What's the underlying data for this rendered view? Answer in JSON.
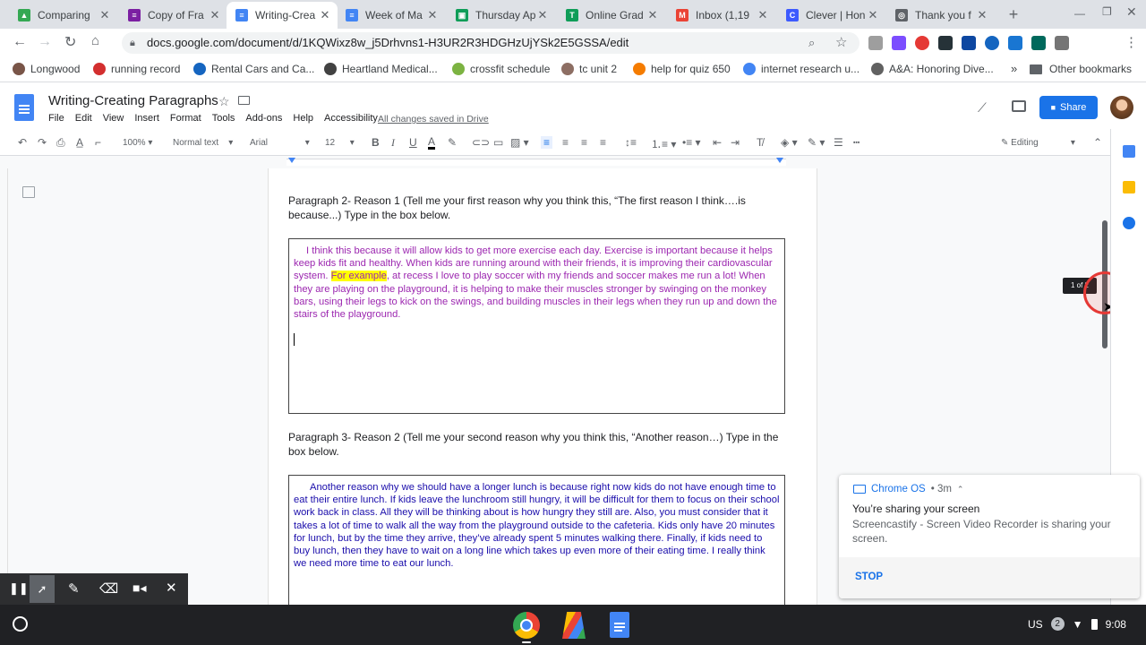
{
  "tabs": [
    {
      "label": "Comparing",
      "color": "#34a853",
      "glyph": "▲"
    },
    {
      "label": "Copy of Fra",
      "color": "#7b1fa2",
      "glyph": "≡"
    },
    {
      "label": "Writing-Crea",
      "color": "#4285f4",
      "glyph": "≡"
    },
    {
      "label": "Week of Ma",
      "color": "#4285f4",
      "glyph": "≡"
    },
    {
      "label": "Thursday Ap",
      "color": "#0f9d58",
      "glyph": "▣"
    },
    {
      "label": "Online Grad",
      "color": "#0f9d58",
      "glyph": "T"
    },
    {
      "label": "Inbox (1,19",
      "color": "#ea4335",
      "glyph": "M"
    },
    {
      "label": "Clever | Hon",
      "color": "#3d5afe",
      "glyph": "C"
    },
    {
      "label": "Thank you f",
      "color": "#5f6368",
      "glyph": "◎"
    }
  ],
  "url": "docs.google.com/document/d/1KQWixz8w_j5Drhvns1-H3UR2R3HDGHzUjYSk2E5GSSA/edit",
  "bookmarks": [
    {
      "label": "Longwood",
      "color": "#795548"
    },
    {
      "label": "running record",
      "color": "#d32f2f"
    },
    {
      "label": "Rental Cars and Ca...",
      "color": "#1565c0"
    },
    {
      "label": "Heartland Medical...",
      "color": "#424242"
    },
    {
      "label": "crossfit schedule",
      "color": "#7cb342"
    },
    {
      "label": "tc unit 2",
      "color": "#8d6e63"
    },
    {
      "label": "help for quiz 650",
      "color": "#f57c00"
    },
    {
      "label": "internet research u...",
      "color": "#4285f4"
    },
    {
      "label": "A&A: Honoring Dive...",
      "color": "#616161"
    }
  ],
  "bookmarks_more": "»",
  "other_bookmarks": "Other bookmarks",
  "doc": {
    "title": "Writing-Creating Paragraphs",
    "menus": [
      "File",
      "Edit",
      "View",
      "Insert",
      "Format",
      "Tools",
      "Add-ons",
      "Help",
      "Accessibility"
    ],
    "save_status": "All changes saved in Drive",
    "share_label": "Share"
  },
  "toolbar": {
    "zoom": "100%",
    "style": "Normal text",
    "font": "Arial",
    "size": "12",
    "mode": "Editing"
  },
  "content": {
    "p2_prompt": "Paragraph 2- Reason 1 (Tell me your first reason why you think this, “The first reason I think….is because...) Type in the box below.",
    "box1_before": "I think this because it will allow kids to get more exercise each day.  Exercise is important because it helps keep kids fit and healthy. When kids are running around with their friends, it is improving their cardiovascular system. ",
    "box1_highlight": "For example",
    "box1_after": ", at recess I love to play soccer with my friends and soccer makes me run a lot! When they are playing on the playground, it is helping to make their muscles stronger by swinging on the monkey bars, using their legs to kick on the swings, and building muscles in their legs when they run up and down the stairs of the playground.",
    "p3_prompt": "Paragraph 3- Reason 2 (Tell me your second reason why you think this, “Another reason…) Type in the box below.",
    "box2_text": "Another reason why we should have a longer lunch is because right now kids do not have enough time to eat their entire lunch. If kids leave the lunchroom still hungry, it will be difficult for them to focus on their school work back in class. All they will be thinking about is how hungry they still are. Also, you must consider that it takes a lot of time to walk all the way from the playground outside to the cafeteria. Kids only have 20 minutes for lunch, but by the time they arrive, they’ve already spent 5 minutes walking there. Finally, if kids need to buy lunch, then they have to wait on a long line which takes up even more of their eating time. I really think we need more time to eat our lunch."
  },
  "page_tooltip": "1 of 2",
  "notification": {
    "source": "Chrome OS",
    "age": "• 3m",
    "title": "You’re sharing your screen",
    "body": "Screencastify - Screen Video Recorder is sharing your screen.",
    "action": "STOP"
  },
  "tray": {
    "lang": "US",
    "badge": "2",
    "time": "9:08"
  },
  "colors": {
    "box1_text": "#9c27b0",
    "box2_text": "#1a0dab",
    "highlight": "#ffff00",
    "share_bg": "#1a73e8"
  }
}
